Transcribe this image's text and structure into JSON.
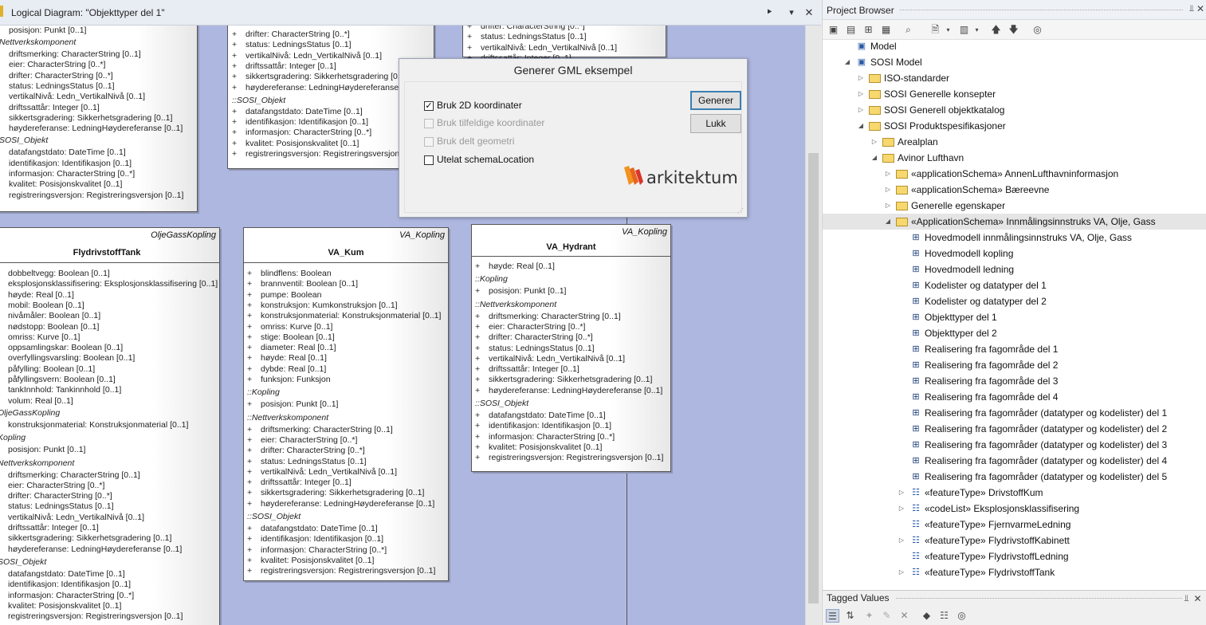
{
  "diagram_window": {
    "title": "Logical Diagram: \"Objekttyper del 1\"",
    "controls": [
      "chevron-icon",
      "dropdown-icon",
      "close-icon"
    ]
  },
  "classes": {
    "top_left": {
      "attrs": [
        {
          "plus": false,
          "text": "posisjon: Punkt [0..1]"
        }
      ],
      "sections": [
        {
          "name": "Nettverkskomponent",
          "attrs": [
            "driftsmerking: CharacterString [0..1]",
            "eier: CharacterString [0..*]",
            "drifter: CharacterString [0..*]",
            "status: LedningsStatus [0..1]",
            "vertikalNivå: Ledn_VertikalNivå [0..1]",
            "driftssattår: Integer [0..1]",
            "sikkertsgradering: Sikkerhetsgradering [0..1]",
            "høydereferanse: LedningHøydereferanse [0..1]"
          ]
        },
        {
          "name": "SOSI_Objekt",
          "attrs": [
            "datafangstdato: DateTime [0..1]",
            "identifikasjon: Identifikasjon [0..1]",
            "informasjon: CharacterString [0..*]",
            "kvalitet: Posisjonskvalitet [0..1]",
            "registreringsversjon: Registreringsversjon [0..1]"
          ]
        }
      ]
    },
    "top_middle": {
      "attrs": [
        "drifter: CharacterString [0..*]",
        "status: LedningsStatus [0..1]",
        "vertikalNivå: Ledn_VertikalNivå [0..1]",
        "driftssattår: Integer [0..1]",
        "sikkertsgradering: Sikkerhetsgradering [0...",
        "høydereferanse: LedningHøydereferanse ..."
      ],
      "section": {
        "name": "::SOSI_Objekt",
        "attrs": [
          "datafangstdato: DateTime [0..1]",
          "identifikasjon: Identifikasjon [0..1]",
          "informasjon: CharacterString [0..*]",
          "kvalitet: Posisjonskvalitet [0..1]",
          "registreringsversjon: Registreringsversjon"
        ]
      }
    },
    "top_right": {
      "attrs": [
        "drifter: CharacterString [0..*]",
        "status: LedningsStatus [0..1]",
        "vertikalNivå: Ledn_VertikalNivå [0..1]",
        "driftssattår: Integer [0..1]"
      ]
    },
    "flydrivstofftank": {
      "stereotype": "OljeGassKopling",
      "name": "FlydrivstoffTank",
      "attrs": [
        "dobbeltvegg: Boolean [0..1]",
        "eksplosjonsklassifisering: Eksplosjonsklassifisering [0..1]",
        "høyde: Real [0..1]",
        "mobil: Boolean [0..1]",
        "nivåmåler: Boolean [0..1]",
        "nødstopp: Boolean [0..1]",
        "omriss: Kurve [0..1]",
        "oppsamlingskar: Boolean [0..1]",
        "overfyllingsvarsling: Boolean [0..1]",
        "påfylling: Boolean [0..1]",
        "påfyllingsvern: Boolean [0..1]",
        "tankInnhold: Tankinnhold [0..1]",
        "volum: Real [0..1]"
      ],
      "sections": [
        {
          "name": "OljeGassKopling",
          "attrs": [
            "konstruksjonmaterial: Konstruksjonmaterial [0..1]"
          ]
        },
        {
          "name": "Kopling",
          "attrs": [
            "posisjon: Punkt [0..1]"
          ]
        },
        {
          "name": "Nettverkskomponent",
          "attrs": [
            "driftsmerking: CharacterString [0..1]",
            "eier: CharacterString [0..*]",
            "drifter: CharacterString [0..*]",
            "status: LedningsStatus [0..1]",
            "vertikalNivå: Ledn_VertikalNivå [0..1]",
            "driftssattår: Integer [0..1]",
            "sikkertsgradering: Sikkerhetsgradering [0..1]",
            "høydereferanse: LedningHøydereferanse [0..1]"
          ]
        },
        {
          "name": "SOSI_Objekt",
          "attrs": [
            "datafangstdato: DateTime [0..1]",
            "identifikasjon: Identifikasjon [0..1]",
            "informasjon: CharacterString [0..*]",
            "kvalitet: Posisjonskvalitet [0..1]",
            "registreringsversjon: Registreringsversjon [0..1]"
          ]
        }
      ]
    },
    "va_kum": {
      "stereotype": "VA_Kopling",
      "name": "VA_Kum",
      "attrs": [
        "blindflens: Boolean",
        "brannventil: Boolean [0..1]",
        "pumpe: Boolean",
        "konstruksjon: Kumkonstruksjon [0..1]",
        "konstruksjonmaterial: Konstruksjonmaterial [0..1]",
        "omriss: Kurve [0..1]",
        "stige: Boolean [0..1]",
        "diameter: Real [0..1]",
        "høyde: Real [0..1]",
        "dybde: Real [0..1]",
        "funksjon: Funksjon"
      ],
      "sections": [
        {
          "name": "::Kopling",
          "attrs": [
            "posisjon: Punkt [0..1]"
          ]
        },
        {
          "name": "::Nettverkskomponent",
          "attrs": [
            "driftsmerking: CharacterString [0..1]",
            "eier: CharacterString [0..*]",
            "drifter: CharacterString [0..*]",
            "status: LedningsStatus [0..1]",
            "vertikalNivå: Ledn_VertikalNivå [0..1]",
            "driftssattår: Integer [0..1]",
            "sikkertsgradering: Sikkerhetsgradering [0..1]",
            "høydereferanse: LedningHøydereferanse [0..1]"
          ]
        },
        {
          "name": "::SOSI_Objekt",
          "attrs": [
            "datafangstdato: DateTime [0..1]",
            "identifikasjon: Identifikasjon [0..1]",
            "informasjon: CharacterString [0..*]",
            "kvalitet: Posisjonskvalitet [0..1]",
            "registreringsversjon: Registreringsversjon [0..1]"
          ]
        }
      ]
    },
    "va_hydrant": {
      "stereotype": "VA_Kopling",
      "name": "VA_Hydrant",
      "attrs": [
        "høyde: Real [0..1]"
      ],
      "sections": [
        {
          "name": "::Kopling",
          "attrs": [
            "posisjon: Punkt [0..1]"
          ]
        },
        {
          "name": "::Nettverkskomponent",
          "attrs": [
            "driftsmerking: CharacterString [0..1]",
            "eier: CharacterString [0..*]",
            "drifter: CharacterString [0..*]",
            "status: LedningsStatus [0..1]",
            "vertikalNivå: Ledn_VertikalNivå [0..1]",
            "driftssattår: Integer [0..1]",
            "sikkertsgradering: Sikkerhetsgradering [0..1]",
            "høydereferanse: LedningHøydereferanse [0..1]"
          ]
        },
        {
          "name": "::SOSI_Objekt",
          "attrs": [
            "datafangstdato: DateTime [0..1]",
            "identifikasjon: Identifikasjon [0..1]",
            "informasjon: CharacterString [0..*]",
            "kvalitet: Posisjonskvalitet [0..1]",
            "registreringsversjon: Registreringsversjon [0..1]"
          ]
        }
      ]
    }
  },
  "dialog": {
    "title": "Generer GML eksempel",
    "options": [
      {
        "label": "Bruk 2D koordinater",
        "checked": true,
        "disabled": false
      },
      {
        "label": "Bruk tilfeldige koordinater",
        "checked": false,
        "disabled": true
      },
      {
        "label": "Bruk delt geometri",
        "checked": false,
        "disabled": true
      },
      {
        "label": "Utelat schemaLocation",
        "checked": false,
        "disabled": false
      }
    ],
    "generate_label": "Generer",
    "close_label": "Lukk",
    "logo_text": "arkitektum"
  },
  "project_browser": {
    "title": "Project Browser",
    "tree": [
      {
        "depth": 0,
        "exp": "",
        "icon": "model",
        "label": "Model"
      },
      {
        "depth": 0,
        "exp": "open",
        "icon": "model",
        "label": "SOSI Model"
      },
      {
        "depth": 1,
        "exp": "closed",
        "icon": "package",
        "label": "ISO-standarder"
      },
      {
        "depth": 1,
        "exp": "closed",
        "icon": "package",
        "label": "SOSI Generelle konsepter"
      },
      {
        "depth": 1,
        "exp": "closed",
        "icon": "package",
        "label": "SOSI Generell objektkatalog"
      },
      {
        "depth": 1,
        "exp": "open",
        "icon": "package",
        "label": "SOSI Produktspesifikasjoner"
      },
      {
        "depth": 2,
        "exp": "closed",
        "icon": "package",
        "label": "Arealplan"
      },
      {
        "depth": 2,
        "exp": "open",
        "icon": "package",
        "label": "Avinor Lufthavn"
      },
      {
        "depth": 3,
        "exp": "closed",
        "icon": "package",
        "label": "«applicationSchema» AnnenLufthavninformasjon"
      },
      {
        "depth": 3,
        "exp": "closed",
        "icon": "package",
        "label": "«applicationSchema» Bæreevne"
      },
      {
        "depth": 3,
        "exp": "closed",
        "icon": "package",
        "label": "Generelle egenskaper"
      },
      {
        "depth": 3,
        "exp": "open",
        "icon": "package",
        "label": "«ApplicationSchema» Innmålingsinnstruks VA, Olje, Gass",
        "selected": true
      },
      {
        "depth": 4,
        "exp": "",
        "icon": "diagram",
        "label": "Hovedmodell innmålingsinnstruks VA, Olje, Gass"
      },
      {
        "depth": 4,
        "exp": "",
        "icon": "diagram",
        "label": "Hovedmodell kopling"
      },
      {
        "depth": 4,
        "exp": "",
        "icon": "diagram",
        "label": "Hovedmodell ledning"
      },
      {
        "depth": 4,
        "exp": "",
        "icon": "diagram",
        "label": "Kodelister og datatyper del 1"
      },
      {
        "depth": 4,
        "exp": "",
        "icon": "diagram",
        "label": "Kodelister og datatyper del 2"
      },
      {
        "depth": 4,
        "exp": "",
        "icon": "diagram",
        "label": "Objekttyper del 1"
      },
      {
        "depth": 4,
        "exp": "",
        "icon": "diagram",
        "label": "Objekttyper del 2"
      },
      {
        "depth": 4,
        "exp": "",
        "icon": "diagram",
        "label": "Realisering fra fagområde del 1"
      },
      {
        "depth": 4,
        "exp": "",
        "icon": "diagram",
        "label": "Realisering fra fagområde del 2"
      },
      {
        "depth": 4,
        "exp": "",
        "icon": "diagram",
        "label": "Realisering fra fagområde del 3"
      },
      {
        "depth": 4,
        "exp": "",
        "icon": "diagram",
        "label": "Realisering fra fagområde del 4"
      },
      {
        "depth": 4,
        "exp": "",
        "icon": "diagram",
        "label": "Realisering fra fagområder (datatyper og kodelister) del 1"
      },
      {
        "depth": 4,
        "exp": "",
        "icon": "diagram",
        "label": "Realisering fra fagområder (datatyper og kodelister) del 2"
      },
      {
        "depth": 4,
        "exp": "",
        "icon": "diagram",
        "label": "Realisering fra fagområder (datatyper og kodelister) del 3"
      },
      {
        "depth": 4,
        "exp": "",
        "icon": "diagram",
        "label": "Realisering fra fagområder (datatyper og kodelister) del 4"
      },
      {
        "depth": 4,
        "exp": "",
        "icon": "diagram",
        "label": "Realisering fra fagområder (datatyper og kodelister) del 5"
      },
      {
        "depth": 4,
        "exp": "closed",
        "icon": "class",
        "label": "«featureType» DrivstoffKum"
      },
      {
        "depth": 4,
        "exp": "closed",
        "icon": "class",
        "label": "«codeList» Eksplosjonsklassifisering"
      },
      {
        "depth": 4,
        "exp": "",
        "icon": "class",
        "label": "«featureType» FjernvarmeLedning"
      },
      {
        "depth": 4,
        "exp": "closed",
        "icon": "class",
        "label": "«featureType» FlydrivstoffKabinett"
      },
      {
        "depth": 4,
        "exp": "",
        "icon": "class",
        "label": "«featureType» FlydrivstoffLedning"
      },
      {
        "depth": 4,
        "exp": "closed",
        "icon": "class",
        "label": "«featureType» FlydrivstoffTank"
      }
    ]
  },
  "tagged_values": {
    "title": "Tagged Values"
  },
  "colors": {
    "canvas": "#aeb7e0",
    "selection": "#e5e5e5",
    "logo_orange": "#f39220",
    "logo_red": "#d9362a"
  }
}
